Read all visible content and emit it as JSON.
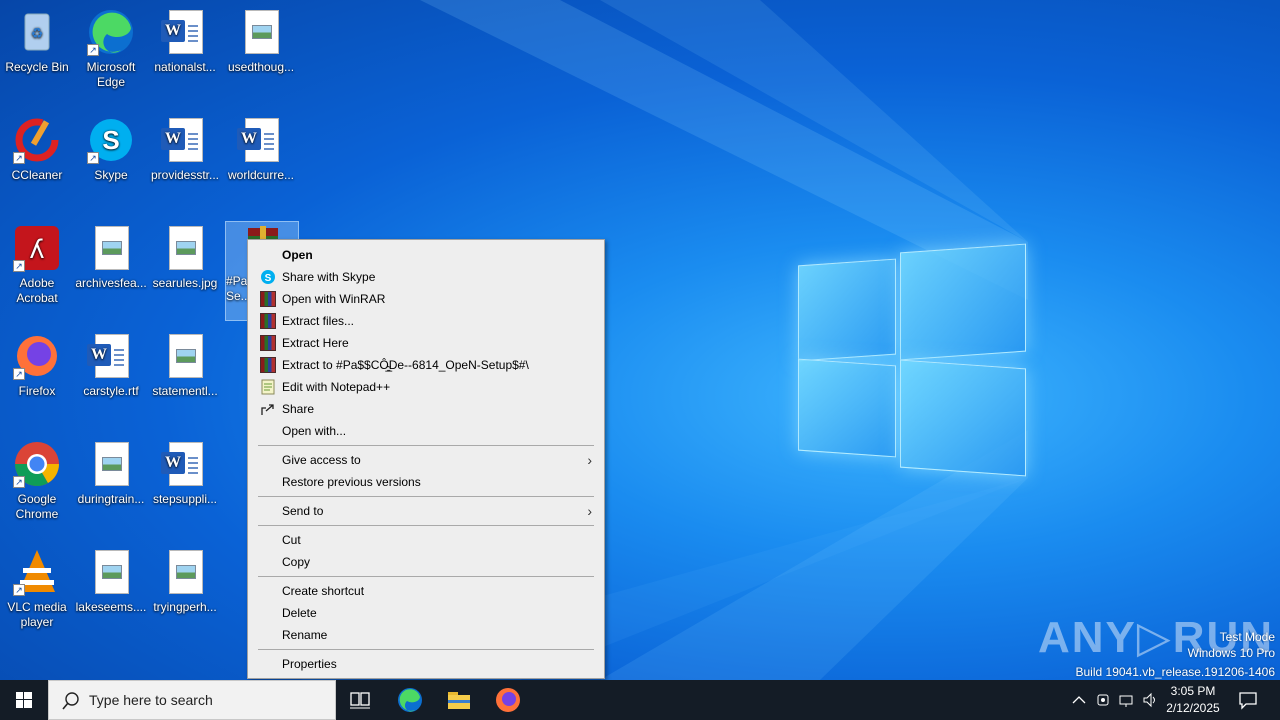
{
  "desktop": {
    "icons": [
      {
        "label": "Recycle Bin"
      },
      {
        "label": "Microsoft Edge"
      },
      {
        "label": "nationalst..."
      },
      {
        "label": "usedthoug..."
      },
      {
        "label": "CCleaner"
      },
      {
        "label": "Skype"
      },
      {
        "label": "providesstr..."
      },
      {
        "label": "worldcurre..."
      },
      {
        "label": "Adobe Acrobat"
      },
      {
        "label": "archivesfea..."
      },
      {
        "label": "searules.jpg"
      },
      {
        "label": "#Pa...-68...-Se..."
      },
      {
        "label": "Firefox"
      },
      {
        "label": "carstyle.rtf"
      },
      {
        "label": "statementl..."
      },
      {
        "label": "Google Chrome"
      },
      {
        "label": "duringtrain..."
      },
      {
        "label": "stepsuppli..."
      },
      {
        "label": "VLC media player"
      },
      {
        "label": "lakeseems...."
      },
      {
        "label": "tryingperh..."
      }
    ]
  },
  "context_menu": {
    "items": [
      {
        "label": "Open"
      },
      {
        "label": "Share with Skype"
      },
      {
        "label": "Open with WinRAR"
      },
      {
        "label": "Extract files..."
      },
      {
        "label": "Extract Here"
      },
      {
        "label": "Extract to #Pa$$CÔ̴̱̲De--6814_OpeN-Setup$#\\"
      },
      {
        "label": "Edit with Notepad++"
      },
      {
        "label": "Share"
      },
      {
        "label": "Open with..."
      },
      {
        "label": "Give access to"
      },
      {
        "label": "Restore previous versions"
      },
      {
        "label": "Send to"
      },
      {
        "label": "Cut"
      },
      {
        "label": "Copy"
      },
      {
        "label": "Create shortcut"
      },
      {
        "label": "Delete"
      },
      {
        "label": "Rename"
      },
      {
        "label": "Properties"
      }
    ]
  },
  "taskbar": {
    "search_placeholder": "Type here to search",
    "time": "3:05 PM",
    "date": "2/12/2025"
  },
  "watermark": {
    "line1": "Test Mode",
    "line2": "Windows 10 Pro",
    "line3": "Build 19041.vb_release.191206-1406",
    "brand": "ANY RUN"
  }
}
